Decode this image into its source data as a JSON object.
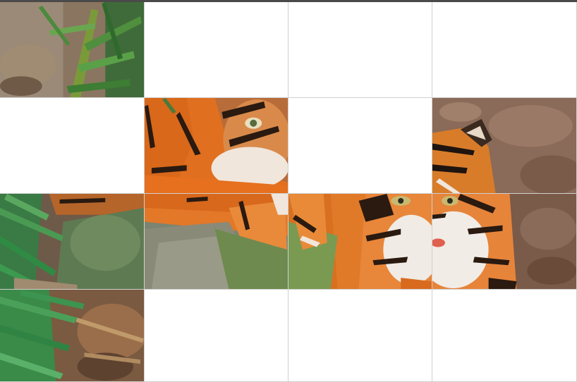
{
  "puzzle": {
    "rows": 4,
    "cols": 4,
    "tiles": [
      {
        "row": 0,
        "col": 0,
        "content": "leaves-grass",
        "filled": true
      },
      {
        "row": 0,
        "col": 1,
        "content": "",
        "filled": false
      },
      {
        "row": 0,
        "col": 2,
        "content": "",
        "filled": false
      },
      {
        "row": 0,
        "col": 3,
        "content": "",
        "filled": false
      },
      {
        "row": 1,
        "col": 0,
        "content": "",
        "filled": false
      },
      {
        "row": 1,
        "col": 1,
        "content": "tiger-shoulder-eye",
        "filled": true
      },
      {
        "row": 1,
        "col": 2,
        "content": "",
        "filled": false
      },
      {
        "row": 1,
        "col": 3,
        "content": "tiger-ear-leaves",
        "filled": true
      },
      {
        "row": 2,
        "col": 0,
        "content": "leaves-rock",
        "filled": true
      },
      {
        "row": 2,
        "col": 1,
        "content": "tiger-paw-rock",
        "filled": true
      },
      {
        "row": 2,
        "col": 2,
        "content": "tiger-face-left",
        "filled": true
      },
      {
        "row": 2,
        "col": 3,
        "content": "tiger-face-right",
        "filled": true
      },
      {
        "row": 3,
        "col": 0,
        "content": "leaves-ground",
        "filled": true
      },
      {
        "row": 3,
        "col": 1,
        "content": "",
        "filled": false
      },
      {
        "row": 3,
        "col": 2,
        "content": "",
        "filled": false
      },
      {
        "row": 3,
        "col": 3,
        "content": "",
        "filled": false
      }
    ]
  }
}
